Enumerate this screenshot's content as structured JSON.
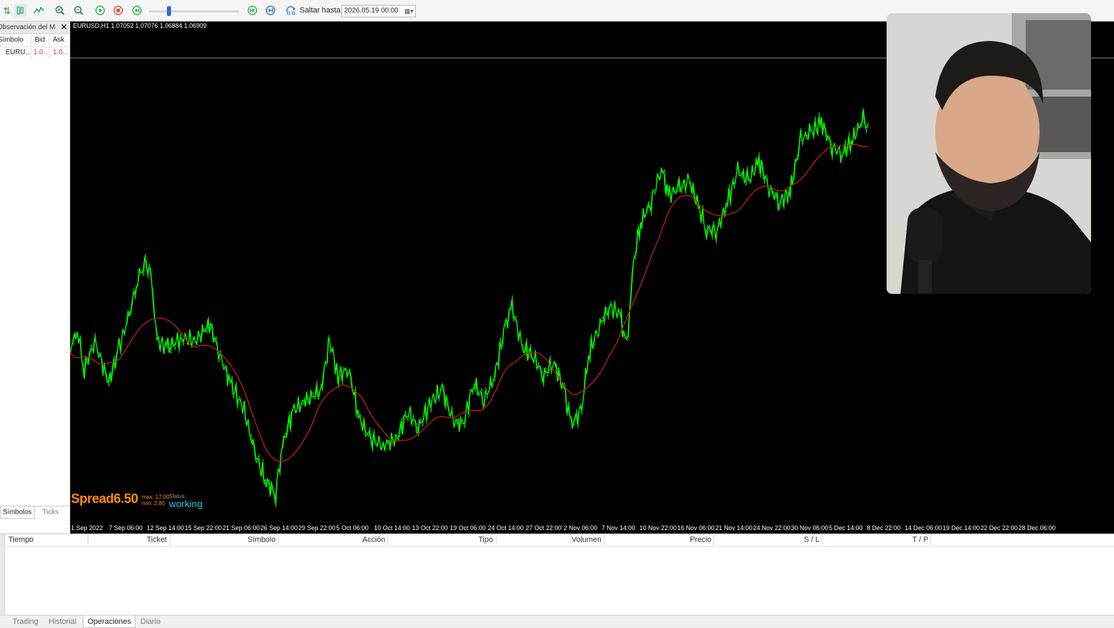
{
  "toolbar": {
    "jump_label": "Saltar hasta",
    "jump_value": "2026.05.19 00:00",
    "icons": [
      "chart-up-icon",
      "candles-icon",
      "line-chart-icon",
      "zoom-in-icon",
      "zoom-out-icon",
      "play-icon",
      "stop-icon",
      "step-back-icon",
      "step-forward-icon",
      "skip-end-icon",
      "jump-to-icon"
    ]
  },
  "market_watch": {
    "title": "Observación del Me...",
    "columns": [
      "Símbolo",
      "Bid",
      "Ask"
    ],
    "rows": [
      {
        "symbol": "EURU...",
        "bid": "1.0...",
        "ask": "1.0..."
      }
    ],
    "tabs": [
      "Símbolos",
      "Ticks"
    ]
  },
  "chart": {
    "info": "EURUSD,H1  1.07052 1.07076 1.06884 1.06909",
    "spread_label": "Spread",
    "spread_value": "6.50",
    "max_text": "max: 17.00",
    "min_text": "min: 2.80",
    "status_label": "Status",
    "status_value": "working",
    "colors": {
      "price": "#00ff00",
      "ma": "#c0201b",
      "background": "#000000",
      "status": "#1ec8e8",
      "spread": "#ff8c00"
    },
    "x_labels": [
      "1 Sep 2022",
      "7 Sep 06:00",
      "12 Sep 14:00",
      "15 Sep 22:00",
      "21 Sep 06:00",
      "26 Sep 14:00",
      "29 Sep 22:00",
      "5 Oct 06:00",
      "10 Oct 14:00",
      "13 Oct 22:00",
      "19 Oct 06:00",
      "24 Oct 14:00",
      "27 Oct 22:00",
      "2 Nov 06:00",
      "7 Nov 14:00",
      "10 Nov 22:00",
      "16 Nov 06:00",
      "21 Nov 14:00",
      "24 Nov 22:00",
      "30 Nov 06:00",
      "5 Dec 14:00",
      "8 Dec 22:00",
      "14 Dec 06:00",
      "19 Dec 14:00",
      "22 Dec 22:00",
      "28 Dec 06:00"
    ]
  },
  "operations": {
    "columns": [
      "Tiempo",
      "Ticket",
      "Símbolo",
      "Acción",
      "Tipo",
      "Volumen",
      "Precio",
      "S / L",
      "T / P"
    ],
    "tabs": [
      "Trading",
      "Historial",
      "Operaciones",
      "Diario"
    ],
    "active_tab": "Operaciones"
  }
}
